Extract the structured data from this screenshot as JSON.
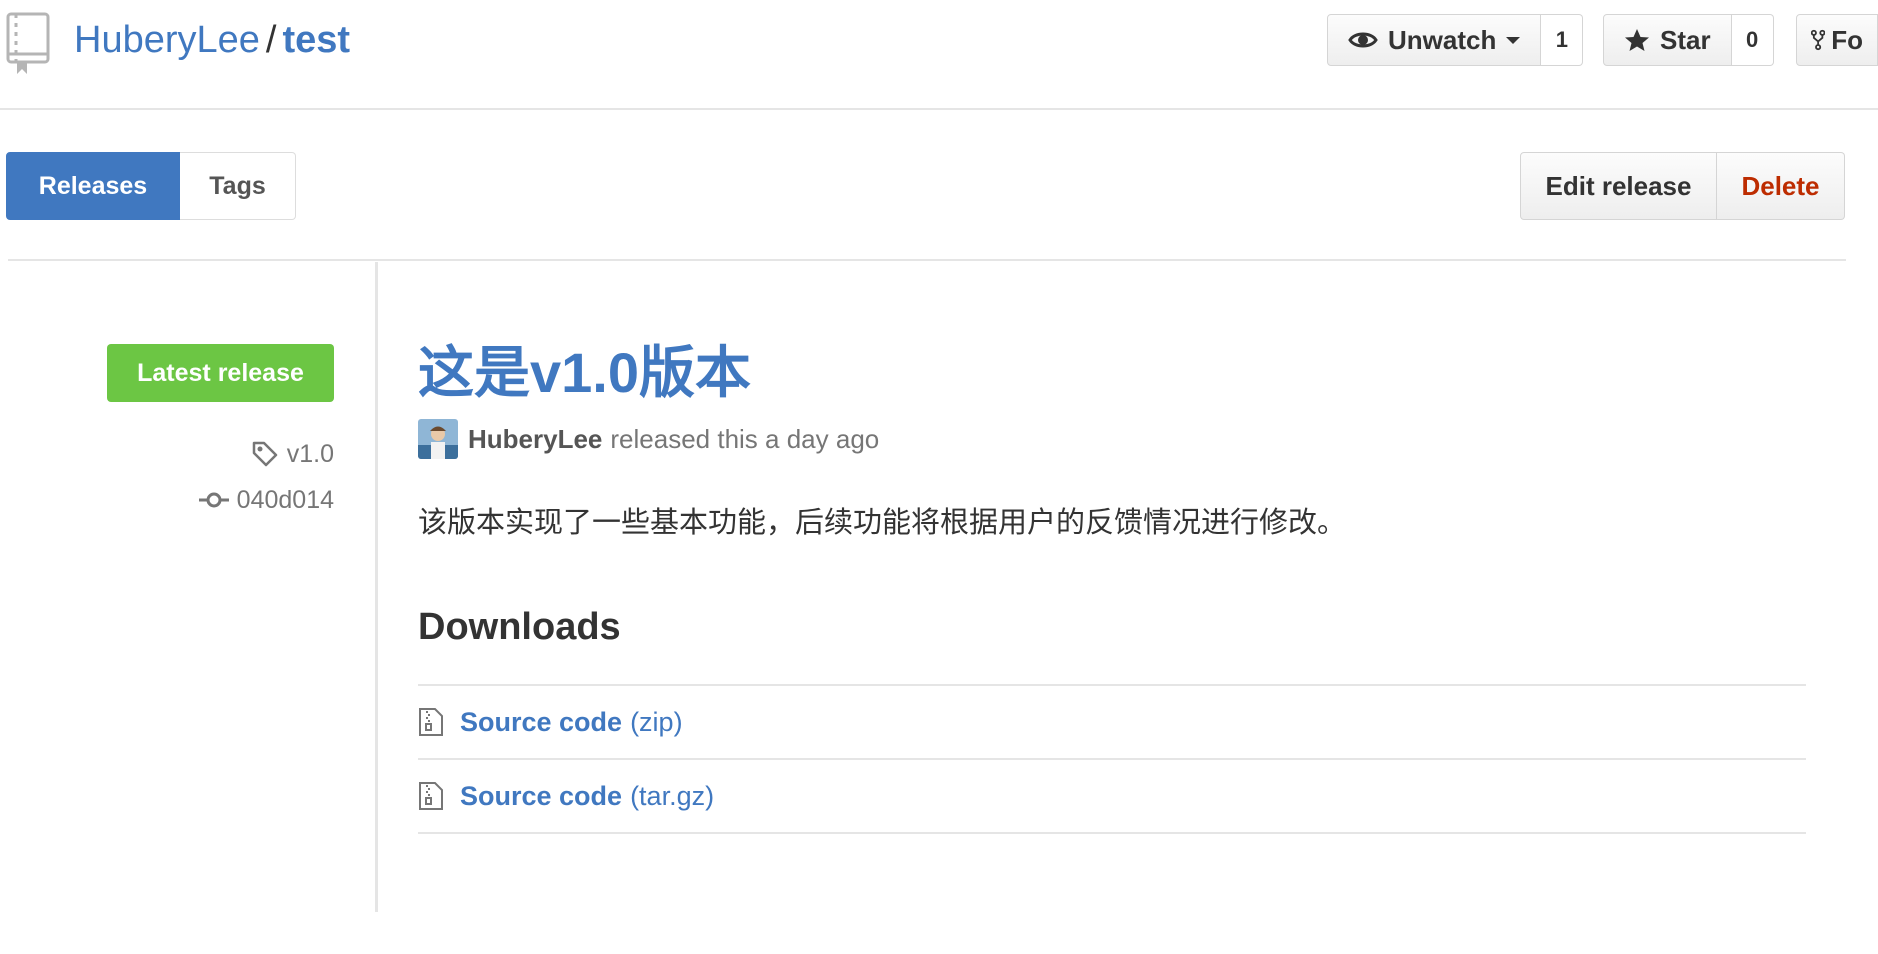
{
  "header": {
    "owner": "HuberyLee",
    "separator": "/",
    "repo": "test",
    "watch": {
      "label": "Unwatch",
      "count": "1"
    },
    "star": {
      "label": "Star",
      "count": "0"
    },
    "fork": {
      "label": "Fo"
    }
  },
  "subnav": {
    "releases_label": "Releases",
    "tags_label": "Tags",
    "edit_label": "Edit release",
    "delete_label": "Delete"
  },
  "release": {
    "latest_label": "Latest release",
    "tag": "v1.0",
    "commit": "040d014",
    "title": "这是v1.0版本",
    "author": "HuberyLee",
    "released_text": "released this a day ago",
    "body": "该版本实现了一些基本功能，后续功能将根据用户的反馈情况进行修改。",
    "downloads_title": "Downloads",
    "downloads": [
      {
        "name": "Source code",
        "ext": "(zip)"
      },
      {
        "name": "Source code",
        "ext": "(tar.gz)"
      }
    ]
  },
  "icons": {
    "repo": "repo-icon",
    "watch": "eye-icon",
    "star": "star-icon",
    "fork": "fork-icon",
    "tag": "tag-icon",
    "commit": "git-commit-icon",
    "file": "file-zip-icon"
  },
  "colors": {
    "link": "#4078c0",
    "success": "#6cc644",
    "danger": "#bd2c00",
    "muted": "#767676"
  }
}
